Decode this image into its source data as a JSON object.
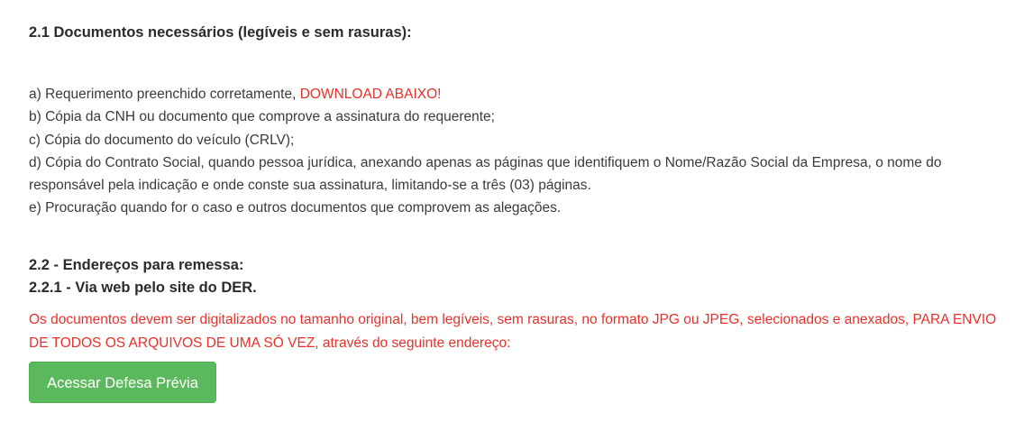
{
  "section_2_1": {
    "heading": "2.1 Documentos necessários (legíveis e sem rasuras):",
    "items": [
      {
        "text": "a) Requerimento preenchido corretamente, ",
        "highlight": "DOWNLOAD ABAIXO!"
      },
      {
        "text": "b) Cópia da CNH ou documento que comprove a assinatura do requerente;"
      },
      {
        "text": "c) Cópia do documento do veículo (CRLV);"
      },
      {
        "text": "d) Cópia do Contrato Social, quando pessoa jurídica, anexando apenas as páginas que identifiquem o Nome/Razão Social da Empresa, o nome do responsável pela indicação e onde conste sua assinatura, limitando-se a três (03) páginas."
      },
      {
        "text": "e) Procuração quando for o caso e outros documentos que comprovem as alegações."
      }
    ]
  },
  "section_2_2": {
    "heading": "2.2 - Endereços para remessa:",
    "subheading": "2.2.1 - Via web pelo site do DER.",
    "note": "Os documentos devem ser digitalizados no tamanho original, bem legíveis, sem rasuras, no formato JPG ou JPEG, selecionados e anexados, PARA ENVIO DE TODOS OS ARQUIVOS DE UMA SÓ VEZ, através do seguinte endereço:",
    "button_label": "Acessar Defesa Prévia"
  },
  "colors": {
    "text": "#3a3a3a",
    "heading": "#2b2b2b",
    "alert": "#e8312a",
    "button": "#5cb85c",
    "button_text": "#ffffff"
  }
}
